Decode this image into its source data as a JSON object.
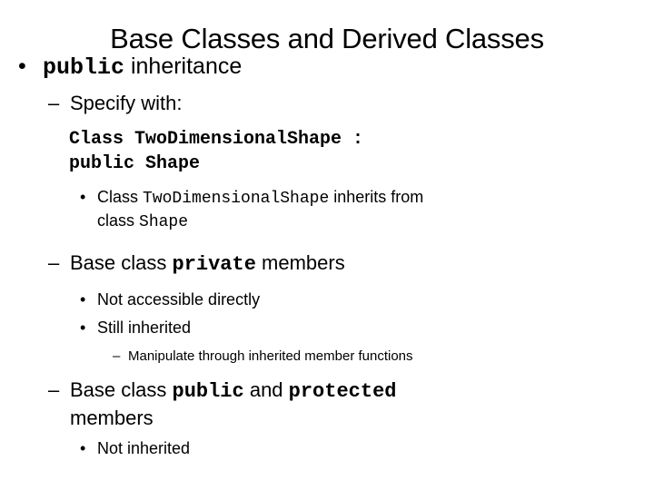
{
  "slide": {
    "title": "Base Classes and Derived Classes",
    "background_color": "#ffffff",
    "text_color": "#000000",
    "bullet_glyph_level1": "•",
    "bullet_glyph_level2": "–",
    "bullet_glyph_level3": "•",
    "bullet_glyph_level4": "–"
  },
  "content": {
    "l1_public_inheritance": {
      "code_word": "public",
      "rest": " inheritance"
    },
    "l2_specify_with": "Specify with:",
    "code_block": {
      "line1": "Class TwoDimensionalShape :",
      "line2": "public Shape"
    },
    "l3_inherits": {
      "part1": "Class ",
      "mono1": "TwoDimensionalShape",
      "part2": " inherits from",
      "part3": "class ",
      "mono2": "Shape"
    },
    "l2_private_members": {
      "part1": "Base class ",
      "mono1": "private",
      "part2": " members"
    },
    "l3_not_accessible": "Not accessible directly",
    "l3_still_inherited": "Still inherited",
    "l4_manipulate": "Manipulate through inherited member functions",
    "l2_public_protected": {
      "part1": "Base class ",
      "mono1": "public",
      "part2": " and ",
      "mono2": "protected",
      "part3": "members"
    },
    "l3_not_inherited": "Not inherited"
  }
}
